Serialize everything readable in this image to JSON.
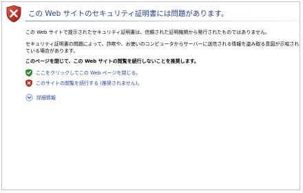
{
  "header": {
    "title": "この Web サイトのセキュリティ証明書には問題があります。",
    "icon": "shield-x-icon"
  },
  "body": {
    "paragraph1": "この Web サイトで提示されたセキュリティ証明書は、信頼された証明機関から発行されたものではありません。",
    "paragraph2": "セキュリティ証明書の問題によって、詐欺や、お使いのコンピュータからサーバーに送信される情報を盗み取る意図が示唆されている場合があります。",
    "recommendation": "このページを閉じて、この Web サイトの閲覧を続行しないことを推奨します。"
  },
  "options": [
    {
      "label": "ここをクリックしてこの Web ページを閉じる。",
      "icon": "green-check-shield-icon"
    },
    {
      "label": "このサイトの閲覧を続行する (推奨されません)。",
      "icon": "red-x-shield-icon"
    }
  ],
  "more_info": {
    "label": "詳細情報",
    "icon": "expand-circle-icon"
  },
  "colors": {
    "title": "#1f3f8f",
    "link": "#1e44a8",
    "danger": "#c0281e",
    "safe": "#2e8b2e"
  }
}
